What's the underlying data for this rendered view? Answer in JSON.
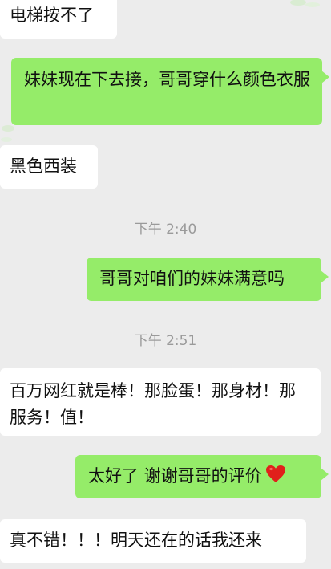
{
  "messages": [
    {
      "side": "in",
      "text": "电梯按不了"
    },
    {
      "side": "out",
      "text": "妹妹现在下去接，哥哥穿什么颜色衣服"
    },
    {
      "side": "in",
      "text": "黑色西装"
    },
    {
      "timestamp": "下午 2:40"
    },
    {
      "side": "out",
      "text": "哥哥对咱们的妹妹满意吗"
    },
    {
      "timestamp": "下午 2:51"
    },
    {
      "side": "in",
      "text": "百万网红就是棒！那脸蛋！那身材！那服务！值！"
    },
    {
      "side": "out",
      "text": "太好了 谢谢哥哥的评价",
      "icon": "red-heart-emoji-icon"
    },
    {
      "side": "in",
      "text": "真不错！！！明天还在的话我还来"
    }
  ],
  "colors": {
    "background": "#ececec",
    "incoming_bubble": "#ffffff",
    "outgoing_bubble": "#95ec69",
    "timestamp_text": "#9a9a9a",
    "heart": "#e0201b"
  }
}
